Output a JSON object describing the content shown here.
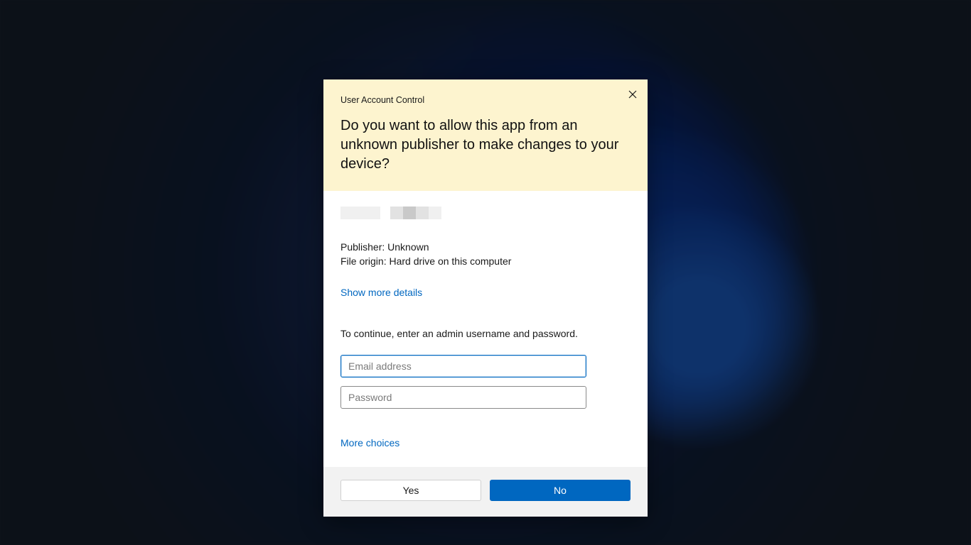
{
  "dialog": {
    "title": "User Account Control",
    "heading": "Do you want to allow this app from an unknown publisher to make changes to your device?",
    "publisher_line": "Publisher: Unknown",
    "origin_line": "File origin: Hard drive on this computer",
    "show_more": "Show more details",
    "continue_prompt": "To continue, enter an admin username and password.",
    "email_placeholder": "Email address",
    "password_placeholder": "Password",
    "more_choices": "More choices",
    "yes_label": "Yes",
    "no_label": "No"
  }
}
